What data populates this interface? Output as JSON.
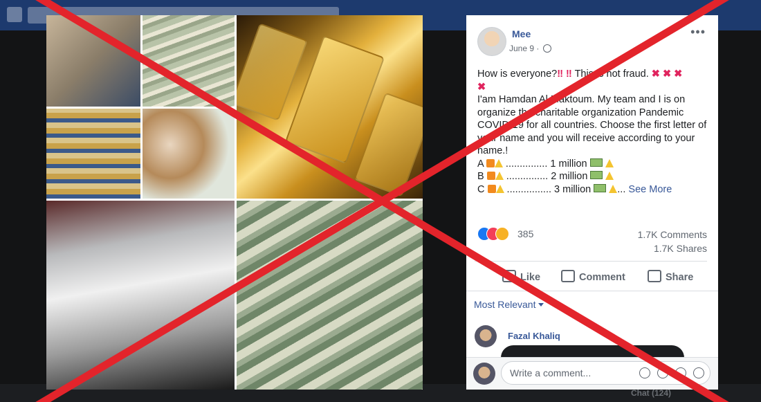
{
  "bottombar": {
    "chat": "Chat (124)"
  },
  "post": {
    "author": "Mee",
    "date": "June 9 ·",
    "intro": "How is everyone?",
    "intro2": " This is not fraud. ",
    "line1": "I'am Hamdan Al Maktoum. My team and I is on organize the charitable organization Pandemic COVID-19 for all countries. Choose the first letter of your name and you will receive according to your name.!",
    "rows": [
      {
        "letter": "A",
        "dots": " ............... ",
        "amount": "1 million"
      },
      {
        "letter": "B",
        "dots": " ............... ",
        "amount": "2 million"
      },
      {
        "letter": "C",
        "dots": " ................ ",
        "amount": "3 million"
      }
    ],
    "see_more": "See More",
    "reactions": "385",
    "comments": "1.7K Comments",
    "shares": "1.7K Shares",
    "actions": {
      "like": "Like",
      "comment": "Comment",
      "share": "Share"
    },
    "most_relevant": "Most Relevant",
    "commenter": "Fazal Khaliq",
    "write_placeholder": "Write a comment..."
  },
  "colors": {
    "overlay_x": "#e3242b",
    "link": "#385898"
  }
}
